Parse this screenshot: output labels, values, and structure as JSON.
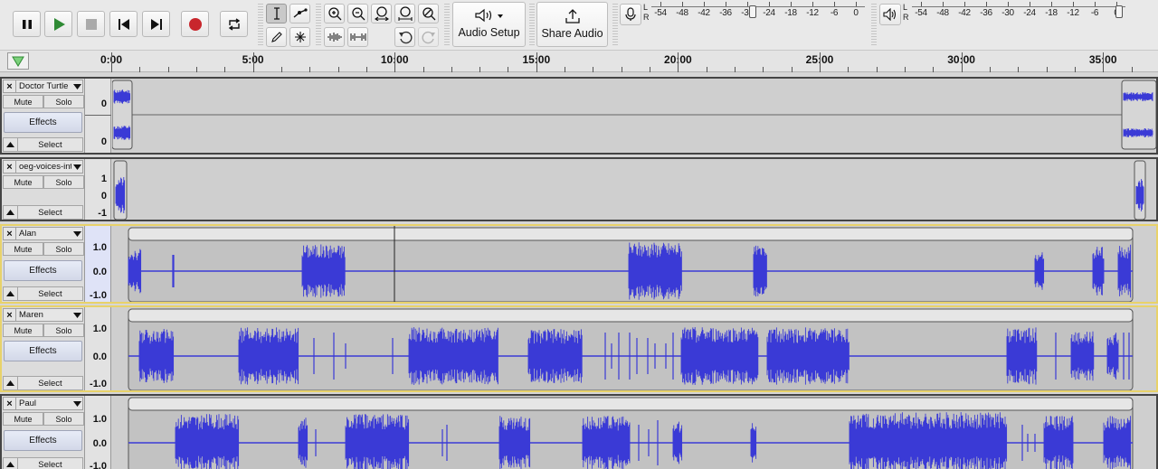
{
  "toolbar": {
    "play_controls": [
      "pause-icon",
      "play-icon",
      "stop-icon",
      "skip-start-icon",
      "skip-end-icon",
      "record-icon",
      "loop-icon"
    ],
    "tools": [
      "ibeam-icon",
      "envelope-icon",
      "pencil-icon",
      "multi-tool-icon"
    ],
    "zoom_tools": [
      "zoom-in-icon",
      "zoom-out-icon",
      "fit-selection-icon",
      "fit-project-icon",
      "zoom-toggle-icon"
    ],
    "edit_tools": [
      "trim-icon",
      "silence-icon",
      "undo-icon",
      "redo-icon"
    ],
    "audio_setup_label": "Audio Setup",
    "share_audio_label": "Share Audio",
    "recording_meter_ticks": [
      "-54",
      "-48",
      "-42",
      "-36",
      "-30",
      "-24",
      "-18",
      "-12",
      "-6",
      "0"
    ],
    "playback_meter_ticks": [
      "-54",
      "-48",
      "-42",
      "-36",
      "-30",
      "-24",
      "-18",
      "-12",
      "-6",
      "0"
    ],
    "meter_channels": [
      "L",
      "R"
    ]
  },
  "ruler": {
    "labels": [
      "0:00",
      "5:00",
      "10:00",
      "15:00",
      "20:00",
      "25:00",
      "30:00",
      "35:00"
    ]
  },
  "colors": {
    "waveform": "#3a3ad6",
    "selection_border": "#e8d26a",
    "record": "#c8262c",
    "play": "#2f8a34"
  },
  "tracks": [
    {
      "name": "Doctor Turtle",
      "mute": "Mute",
      "solo": "Solo",
      "effects": "Effects",
      "select": "Select",
      "scale": [
        "0",
        "0"
      ],
      "stereo": true
    },
    {
      "name": "oeg-voices-int",
      "mute": "Mute",
      "solo": "Solo",
      "effects": "",
      "select": "Select",
      "scale": [
        "1",
        "0",
        "-1"
      ]
    },
    {
      "name": "Alan",
      "mute": "Mute",
      "solo": "Solo",
      "effects": "Effects",
      "select": "Select",
      "scale": [
        "1.0",
        "0.0",
        "-1.0"
      ]
    },
    {
      "name": "Maren",
      "mute": "Mute",
      "solo": "Solo",
      "effects": "Effects",
      "select": "Select",
      "scale": [
        "1.0",
        "0.0",
        "-1.0"
      ]
    },
    {
      "name": "Paul",
      "mute": "Mute",
      "solo": "Solo",
      "effects": "Effects",
      "select": "Select",
      "scale": [
        "1.0",
        "0.0",
        "-1.0"
      ]
    }
  ]
}
